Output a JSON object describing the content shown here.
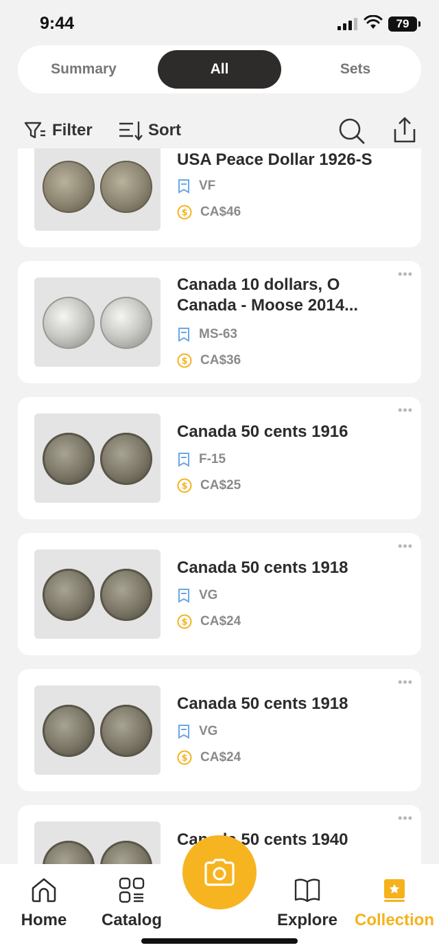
{
  "status": {
    "time": "9:44",
    "battery": "79"
  },
  "segmented": {
    "tabs": [
      "Summary",
      "All",
      "Sets"
    ],
    "active": "All"
  },
  "toolbar": {
    "filter_label": "Filter",
    "sort_label": "Sort"
  },
  "items": [
    {
      "title": "USA Peace Dollar 1926-S",
      "grade": "VF",
      "price": "CA$46"
    },
    {
      "title": "Canada 10 dollars, O Canada - Moose 2014...",
      "grade": "MS-63",
      "price": "CA$36"
    },
    {
      "title": "Canada 50 cents 1916",
      "grade": "F-15",
      "price": "CA$25"
    },
    {
      "title": "Canada 50 cents 1918",
      "grade": "VG",
      "price": "CA$24"
    },
    {
      "title": "Canada 50 cents 1918",
      "grade": "VG",
      "price": "CA$24"
    },
    {
      "title": "Canada 50 cents 1940",
      "grade": "",
      "price": ""
    }
  ],
  "tabbar": {
    "home": "Home",
    "catalog": "Catalog",
    "explore": "Explore",
    "collection": "Collection"
  },
  "colors": {
    "accent": "#f7b421",
    "dark_pill": "#2e2b2b",
    "background": "#f2f2f2"
  },
  "icons": [
    "filter-icon",
    "sort-icon",
    "search-icon",
    "share-icon",
    "grade-icon",
    "price-icon",
    "camera-icon",
    "home-icon",
    "catalog-icon",
    "explore-icon",
    "collection-icon"
  ]
}
